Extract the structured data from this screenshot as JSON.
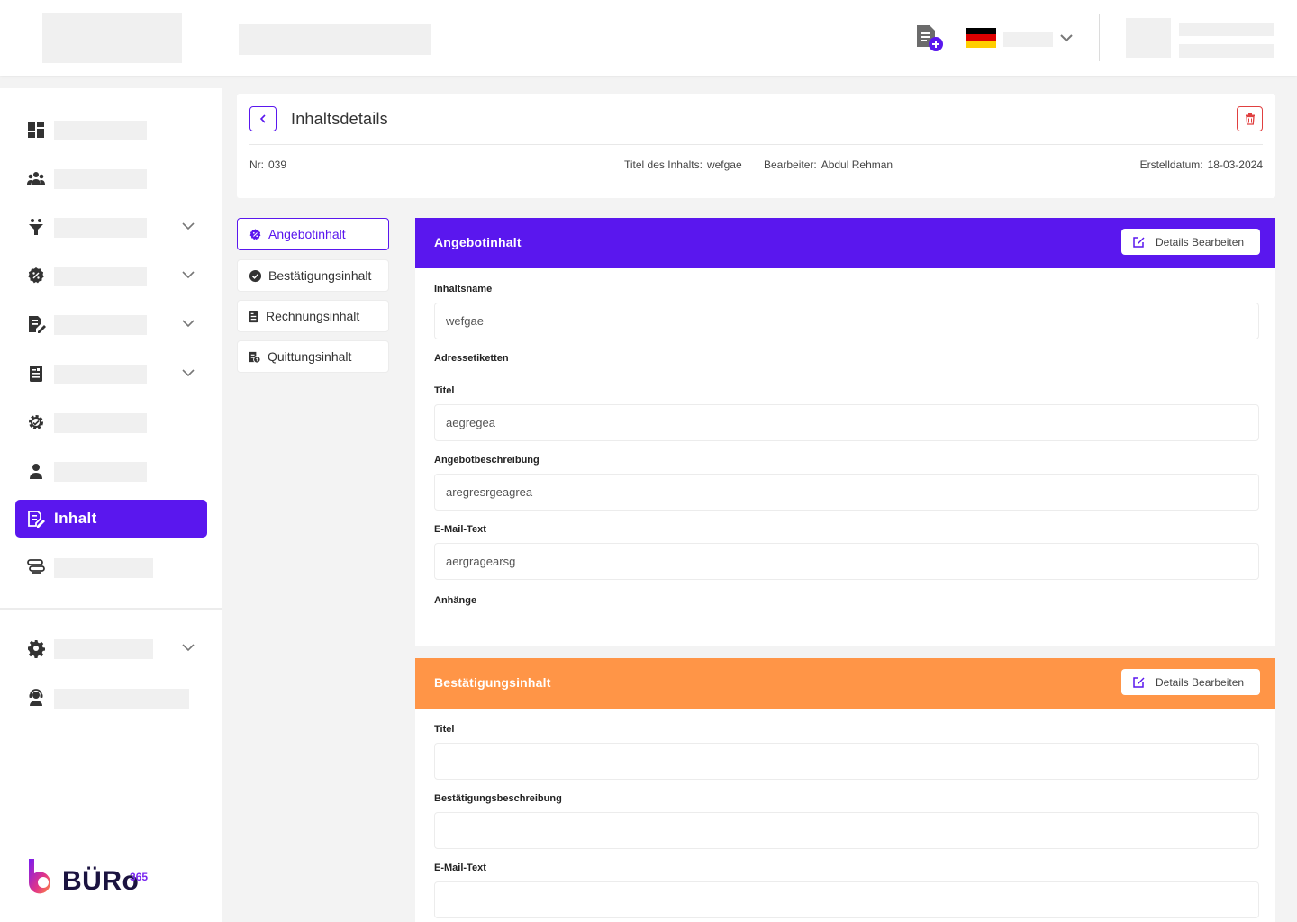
{
  "colors": {
    "accent": "#5A17EE",
    "offer_header": "#5A17EE",
    "confirmation_header": "#FF9547",
    "danger": "#E04040",
    "flag": [
      "#000000",
      "#DD0000",
      "#FFCE00"
    ]
  },
  "sidebar": {
    "icons": [
      "dashboard-icon",
      "users-icon",
      "funnel-icon",
      "badge-icon",
      "edit-document-icon",
      "invoice-icon",
      "settings-cog-icon",
      "person-icon",
      "content-icon",
      "route-icon",
      "gear-icon",
      "support-icon"
    ],
    "active_label": "Inhalt"
  },
  "brand": {
    "name": "BÜRo",
    "sup": "365"
  },
  "header": {
    "title": "Inhaltsdetails",
    "nr_label": "Nr:",
    "nr_value": "039",
    "content_title_label": "Titel des Inhalts:",
    "content_title_value": "wefgae",
    "editor_label": "Bearbeiter:",
    "editor_value": "Abdul Rehman",
    "created_label": "Erstelldatum:",
    "created_value": "18-03-2024"
  },
  "tabs": [
    {
      "label": "Angebotinhalt",
      "icon": "badge-icon"
    },
    {
      "label": "Bestätigungsinhalt",
      "icon": "check-circle-icon"
    },
    {
      "label": "Rechnungsinhalt",
      "icon": "invoice-icon"
    },
    {
      "label": "Quittungsinhalt",
      "icon": "receipt-icon"
    }
  ],
  "offer_panel": {
    "title": "Angebotinhalt",
    "edit_label": "Details Bearbeiten",
    "name_label": "Inhaltsname",
    "name_value": "wefgae",
    "address_label": "Adressetiketten",
    "title_label": "Titel",
    "title_value": "aegregea",
    "desc_label": "Angebotbeschreibung",
    "desc_value": "aregresrgeagrea",
    "email_label": "E-Mail-Text",
    "email_value": "aergragearsg",
    "attachments_label": "Anhänge"
  },
  "confirm_panel": {
    "title": "Bestätigungsinhalt",
    "edit_label": "Details Bearbeiten",
    "title_label": "Titel",
    "title_value": "",
    "desc_label": "Bestätigungsbeschreibung",
    "desc_value": "",
    "email_label": "E-Mail-Text",
    "email_value": ""
  }
}
